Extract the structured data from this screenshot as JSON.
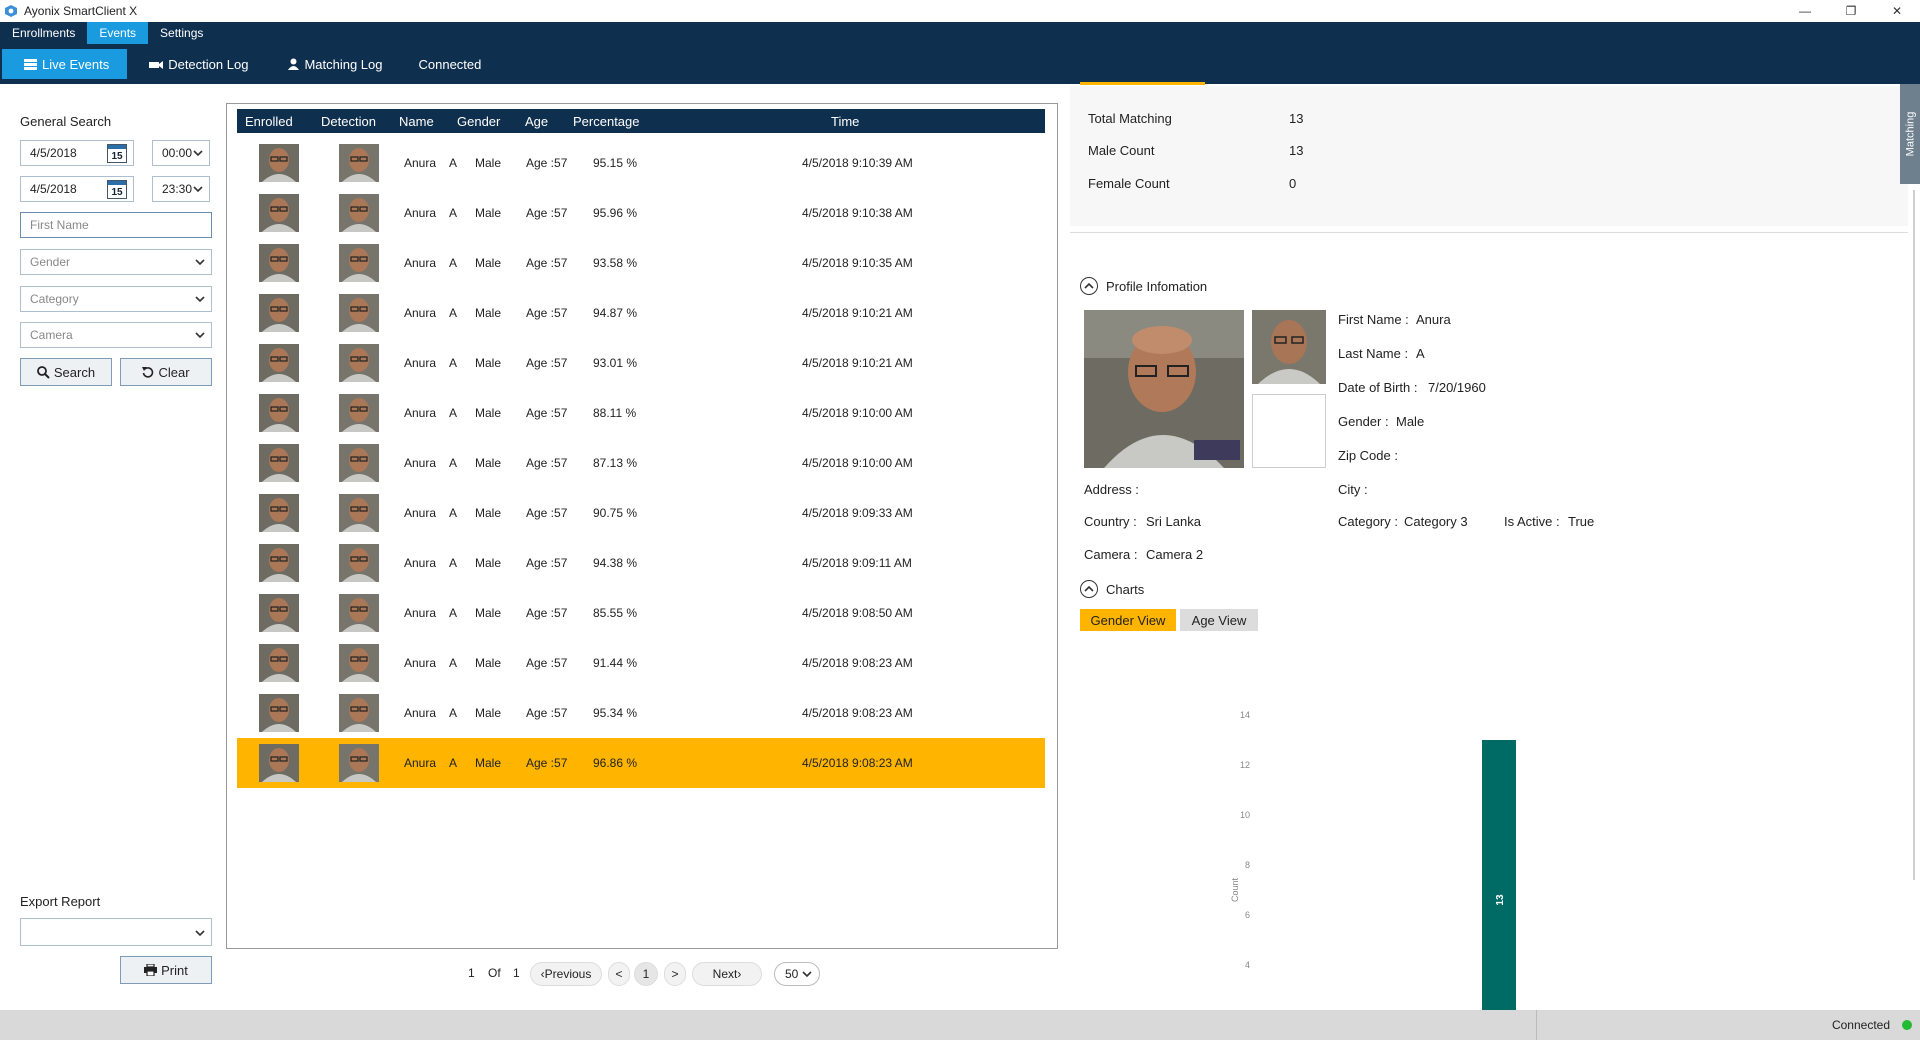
{
  "window": {
    "title": "Ayonix SmartClient X",
    "controls": [
      "—",
      "❐",
      "✕"
    ]
  },
  "menu": {
    "items": [
      {
        "label": "Enrollments",
        "active": false
      },
      {
        "label": "Events",
        "active": true
      },
      {
        "label": "Settings",
        "active": false
      }
    ]
  },
  "subnav": {
    "live_events": "Live Events",
    "detection_log": "Detection Log",
    "matching_log": "Matching Log",
    "status": "Connected"
  },
  "search": {
    "title": "General Search",
    "from_date": "4/5/2018",
    "from_time": "00:00",
    "to_date": "4/5/2018",
    "to_time": "23:30",
    "calendar_day": "15",
    "first_name_placeholder": "First Name",
    "gender_placeholder": "Gender",
    "category_placeholder": "Category",
    "camera_placeholder": "Camera",
    "search_label": "Search",
    "clear_label": "Clear",
    "export_title": "Export Report",
    "export_value": "",
    "print_label": "Print"
  },
  "table": {
    "columns": [
      "Enrolled",
      "Detection",
      "Name",
      "Gender",
      "Age",
      "Percentage",
      "Time"
    ],
    "rows": [
      {
        "first": "Anura",
        "last": "A",
        "gender": "Male",
        "age": "Age :57",
        "percentage": "95.15 %",
        "time": "4/5/2018 9:10:39 AM",
        "selected": false
      },
      {
        "first": "Anura",
        "last": "A",
        "gender": "Male",
        "age": "Age :57",
        "percentage": "95.96 %",
        "time": "4/5/2018 9:10:38 AM",
        "selected": false
      },
      {
        "first": "Anura",
        "last": "A",
        "gender": "Male",
        "age": "Age :57",
        "percentage": "93.58 %",
        "time": "4/5/2018 9:10:35 AM",
        "selected": false
      },
      {
        "first": "Anura",
        "last": "A",
        "gender": "Male",
        "age": "Age :57",
        "percentage": "94.87 %",
        "time": "4/5/2018 9:10:21 AM",
        "selected": false
      },
      {
        "first": "Anura",
        "last": "A",
        "gender": "Male",
        "age": "Age :57",
        "percentage": "93.01 %",
        "time": "4/5/2018 9:10:21 AM",
        "selected": false
      },
      {
        "first": "Anura",
        "last": "A",
        "gender": "Male",
        "age": "Age :57",
        "percentage": "88.11 %",
        "time": "4/5/2018 9:10:00 AM",
        "selected": false
      },
      {
        "first": "Anura",
        "last": "A",
        "gender": "Male",
        "age": "Age :57",
        "percentage": "87.13 %",
        "time": "4/5/2018 9:10:00 AM",
        "selected": false
      },
      {
        "first": "Anura",
        "last": "A",
        "gender": "Male",
        "age": "Age :57",
        "percentage": "90.75 %",
        "time": "4/5/2018 9:09:33 AM",
        "selected": false
      },
      {
        "first": "Anura",
        "last": "A",
        "gender": "Male",
        "age": "Age :57",
        "percentage": "94.38 %",
        "time": "4/5/2018 9:09:11 AM",
        "selected": false
      },
      {
        "first": "Anura",
        "last": "A",
        "gender": "Male",
        "age": "Age :57",
        "percentage": "85.55 %",
        "time": "4/5/2018 9:08:50 AM",
        "selected": false
      },
      {
        "first": "Anura",
        "last": "A",
        "gender": "Male",
        "age": "Age :57",
        "percentage": "91.44 %",
        "time": "4/5/2018 9:08:23 AM",
        "selected": false
      },
      {
        "first": "Anura",
        "last": "A",
        "gender": "Male",
        "age": "Age :57",
        "percentage": "95.34 %",
        "time": "4/5/2018 9:08:23 AM",
        "selected": false
      },
      {
        "first": "Anura",
        "last": "A",
        "gender": "Male",
        "age": "Age :57",
        "percentage": "96.86 %",
        "time": "4/5/2018 9:08:23 AM",
        "selected": true
      }
    ]
  },
  "pager": {
    "current": "1",
    "of_label": "Of",
    "total": "1",
    "previous": "‹Previous",
    "prev_arrow": "<",
    "page": "1",
    "next_arrow": ">",
    "next": "Next›",
    "page_size": "50"
  },
  "stats": {
    "total_matching_label": "Total Matching",
    "total_matching": "13",
    "male_count_label": "Male Count",
    "male_count": "13",
    "female_count_label": "Female Count",
    "female_count": "0"
  },
  "profile": {
    "title": "Profile Infomation",
    "first_name_label": "First Name :",
    "first_name": "Anura",
    "last_name_label": "Last Name :",
    "last_name": "A",
    "dob_label": "Date of Birth :",
    "dob": "7/20/1960",
    "gender_label": "Gender :",
    "gender": "Male",
    "zip_label": "Zip Code :",
    "zip": "",
    "address_label": "Address :",
    "address": "",
    "city_label": "City :",
    "city": "",
    "country_label": "Country :",
    "country": "Sri Lanka",
    "category_label": "Category :",
    "category": "Category 3",
    "active_label": "Is Active :",
    "active": "True",
    "camera_label": "Camera :",
    "camera": "Camera 2"
  },
  "charts": {
    "title": "Charts",
    "tab_gender": "Gender View",
    "tab_age": "Age View",
    "active_tab": "Gender View"
  },
  "chart_data": {
    "type": "bar",
    "categories": [
      ""
    ],
    "values": [
      13
    ],
    "ylabel": "Count",
    "yticks": [
      4,
      6,
      8,
      10,
      12,
      14
    ],
    "ylim": [
      0,
      14
    ],
    "bar_color": "#006b64",
    "data_label": "13"
  },
  "side_tab": {
    "label": "Matching"
  },
  "status_bar": {
    "text": "Connected",
    "dot_color": "#22bb33"
  },
  "colors": {
    "nav": "#0f2f4f",
    "accent": "#1a9be0",
    "highlight": "#ffb400",
    "chart_bar": "#006b64"
  }
}
